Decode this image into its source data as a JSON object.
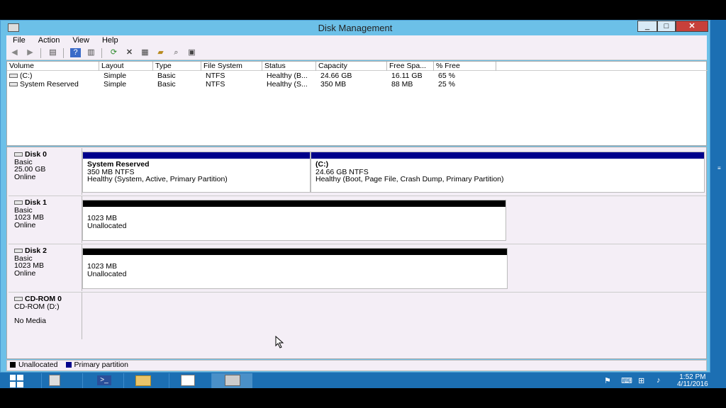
{
  "window": {
    "title": "Disk Management"
  },
  "menu": [
    "File",
    "Action",
    "View",
    "Help"
  ],
  "toolbar_icons": [
    "back-icon",
    "forward-icon",
    "console-tree-icon",
    "help-icon",
    "properties-icon",
    "refresh-icon",
    "delete-icon",
    "settings-icon",
    "folder-open-icon",
    "search-icon",
    "disk-icon"
  ],
  "table": {
    "headers": [
      "Volume",
      "Layout",
      "Type",
      "File System",
      "Status",
      "Capacity",
      "Free Spa...",
      "% Free"
    ],
    "rows": [
      [
        "(C:)",
        "Simple",
        "Basic",
        "NTFS",
        "Healthy (B...",
        "24.66 GB",
        "16.11 GB",
        "65 %"
      ],
      [
        "System Reserved",
        "Simple",
        "Basic",
        "NTFS",
        "Healthy (S...",
        "350 MB",
        "88 MB",
        "25 %"
      ]
    ]
  },
  "disks": [
    {
      "name": "Disk 0",
      "type": "Basic",
      "size": "25.00 GB",
      "state": "Online"
    },
    {
      "name": "Disk 1",
      "type": "Basic",
      "size": "1023 MB",
      "state": "Online"
    },
    {
      "name": "Disk 2",
      "type": "Basic",
      "size": "1023 MB",
      "state": "Online"
    },
    {
      "name": "CD-ROM 0",
      "type": "CD-ROM (D:)",
      "size": "",
      "state": "No Media"
    }
  ],
  "partitions": {
    "d0p1": {
      "title": "System Reserved",
      "line1": "350 MB NTFS",
      "line2": "Healthy (System, Active, Primary Partition)"
    },
    "d0p2": {
      "title": "(C:)",
      "line1": "24.66 GB NTFS",
      "line2": "Healthy (Boot, Page File, Crash Dump, Primary Partition)"
    },
    "d1p1": {
      "line1": "1023 MB",
      "line2": "Unallocated"
    },
    "d2p1": {
      "line1": "1023 MB",
      "line2": "Unallocated"
    }
  },
  "legend": [
    {
      "label": "Unallocated",
      "color": "#000000"
    },
    {
      "label": "Primary partition",
      "color": "#00008b"
    }
  ],
  "clock": {
    "time": "1:52 PM",
    "date": "4/11/2016"
  },
  "colors": {
    "primary": "#00008b",
    "unallocated": "#000000",
    "accent": "#1c6fb3"
  }
}
